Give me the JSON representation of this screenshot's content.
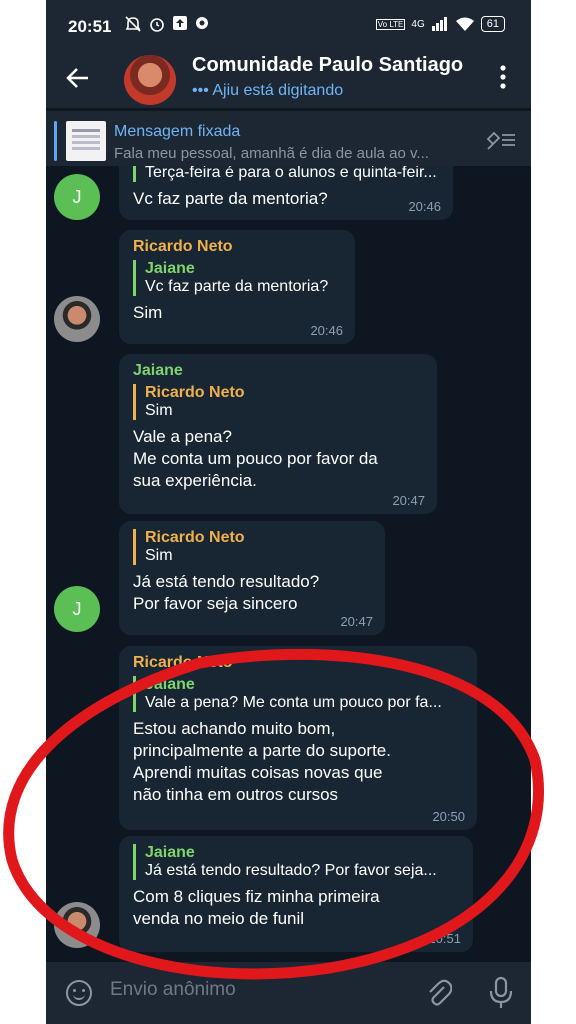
{
  "status_bar": {
    "time": "20:51",
    "icons": [
      "mute-icon",
      "alarm-icon",
      "upload-icon",
      "assistant-icon"
    ],
    "network": "4G",
    "volte": "Vo LTE",
    "battery": "61"
  },
  "header": {
    "title": "Comunidade Paulo Santiago",
    "status": "••• Ajiu está digitando"
  },
  "pinned": {
    "title": "Mensagem fixada",
    "text": "Fala meu pessoal, amanhã é dia de aula ao v..."
  },
  "messages": [
    {
      "avatar": "J",
      "quote_text": "Terça-feira é para o alunos e quinta-feir...",
      "text": "Vc faz parte da mentoria?",
      "time": "20:46"
    },
    {
      "sender": "Ricardo Neto",
      "quote_name": "Jaiane",
      "quote_text": "Vc faz parte da mentoria?",
      "text": "Sim",
      "time": "20:46"
    },
    {
      "sender": "Jaiane",
      "quote_name": "Ricardo Neto",
      "quote_text": "Sim",
      "text_lines": [
        "Vale a pena?",
        "Me conta um pouco por favor da",
        "sua experiência."
      ],
      "time": "20:47"
    },
    {
      "avatar": "J",
      "quote_name": "Ricardo Neto",
      "quote_text": "Sim",
      "text_lines": [
        "Já está tendo resultado?",
        "Por favor seja sincero"
      ],
      "time": "20:47"
    },
    {
      "sender": "Ricardo Neto",
      "quote_name": "Jaiane",
      "quote_text": "Vale a pena? Me conta um pouco por fa...",
      "text_lines": [
        "Estou achando muito bom,",
        "principalmente a parte do suporte.",
        "Aprendi muitas coisas novas que",
        "não tinha em outros cursos"
      ],
      "time": "20:50"
    },
    {
      "quote_name": "Jaiane",
      "quote_text": "Já está tendo resultado? Por favor seja...",
      "text_lines": [
        "Com 8 cliques fiz minha primeira",
        "venda no meio de funil"
      ],
      "time": "20:51"
    }
  ],
  "input": {
    "placeholder": "Envio anônimo"
  },
  "colors": {
    "background": "#0e1621",
    "bubble": "#182533",
    "bar": "#1d2733",
    "accent_blue": "#6eb5f5",
    "ricardo_name": "#f0b04b",
    "jaiane_name": "#7fd46c",
    "annotation_red": "#e0181b"
  }
}
